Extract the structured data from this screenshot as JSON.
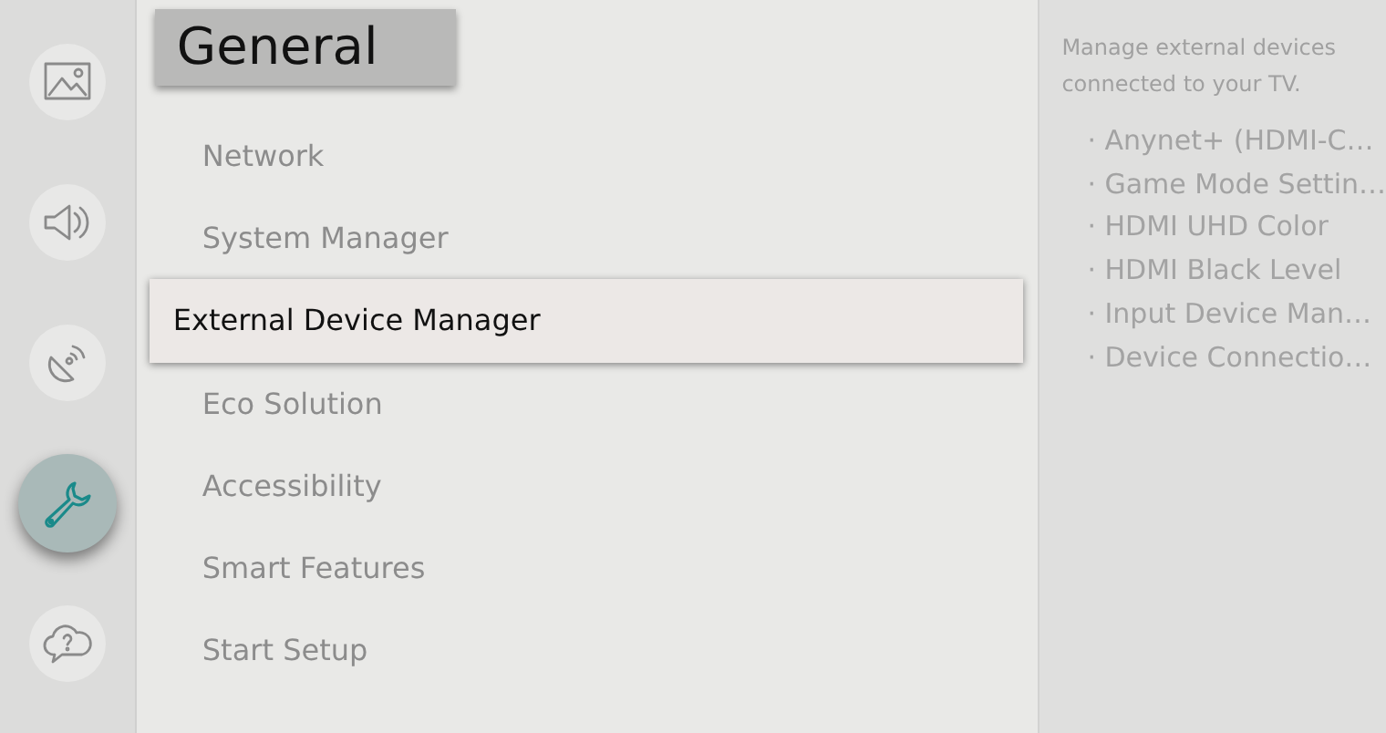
{
  "sidebar": {
    "items": [
      {
        "kind": "picture",
        "selected": false
      },
      {
        "kind": "sound",
        "selected": false
      },
      {
        "kind": "broadcast",
        "selected": false
      },
      {
        "kind": "general",
        "selected": true
      },
      {
        "kind": "support",
        "selected": false
      }
    ]
  },
  "menu": {
    "title": "General",
    "items": [
      {
        "label": "Network",
        "selected": false
      },
      {
        "label": "System Manager",
        "selected": false
      },
      {
        "label": "External Device Manager",
        "selected": true
      },
      {
        "label": "Eco Solution",
        "selected": false
      },
      {
        "label": "Accessibility",
        "selected": false
      },
      {
        "label": "Smart Features",
        "selected": false
      },
      {
        "label": "Start Setup",
        "selected": false
      }
    ]
  },
  "detail": {
    "description": "Manage external devices connected to your TV.",
    "items": [
      "· Anynet+ (HDMI-C…",
      "· Game Mode Settin…",
      "· HDMI UHD Color",
      "· HDMI Black Level",
      "· Input Device Man…",
      "· Device Connectio…"
    ]
  }
}
